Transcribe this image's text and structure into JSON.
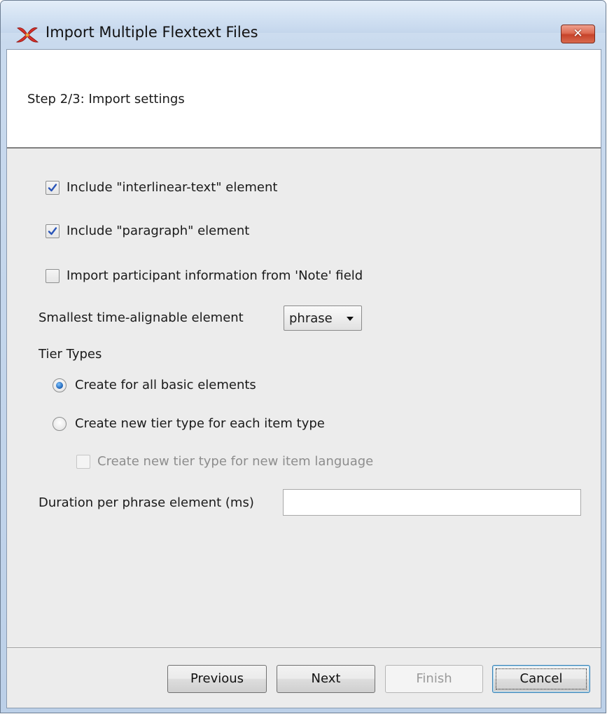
{
  "window": {
    "title": "Import Multiple Flextext Files",
    "close_glyph": "✕"
  },
  "header": {
    "step_title": "Step 2/3: Import settings"
  },
  "options": {
    "include_interlinear": {
      "label": "Include \"interlinear-text\" element",
      "checked": true
    },
    "include_paragraph": {
      "label": "Include \"paragraph\" element",
      "checked": true
    },
    "import_participant": {
      "label": "Import participant information from 'Note' field",
      "checked": false
    }
  },
  "smallest_element": {
    "label": "Smallest time-alignable element",
    "selected": "phrase"
  },
  "tier_types": {
    "heading": "Tier Types",
    "create_all_basic": {
      "label": "Create for all basic elements",
      "selected": true
    },
    "create_per_item": {
      "label": "Create new tier type for each item type",
      "selected": false
    },
    "create_per_language": {
      "label": "Create new tier type for new item language",
      "checked": false,
      "enabled": false
    }
  },
  "duration": {
    "label": "Duration per phrase element (ms)",
    "value": ""
  },
  "buttons": {
    "previous": "Previous",
    "next": "Next",
    "finish": "Finish",
    "cancel": "Cancel"
  },
  "colors": {
    "title_bar": "#d3e2f3",
    "close_button": "#c7432a",
    "dialog_bg": "#ececec",
    "radio_accent": "#1a5fb4"
  },
  "icons": {
    "app": "elan-app-icon",
    "close": "close-icon",
    "check": "checkmark-icon",
    "dropdown": "chevron-down-icon"
  }
}
